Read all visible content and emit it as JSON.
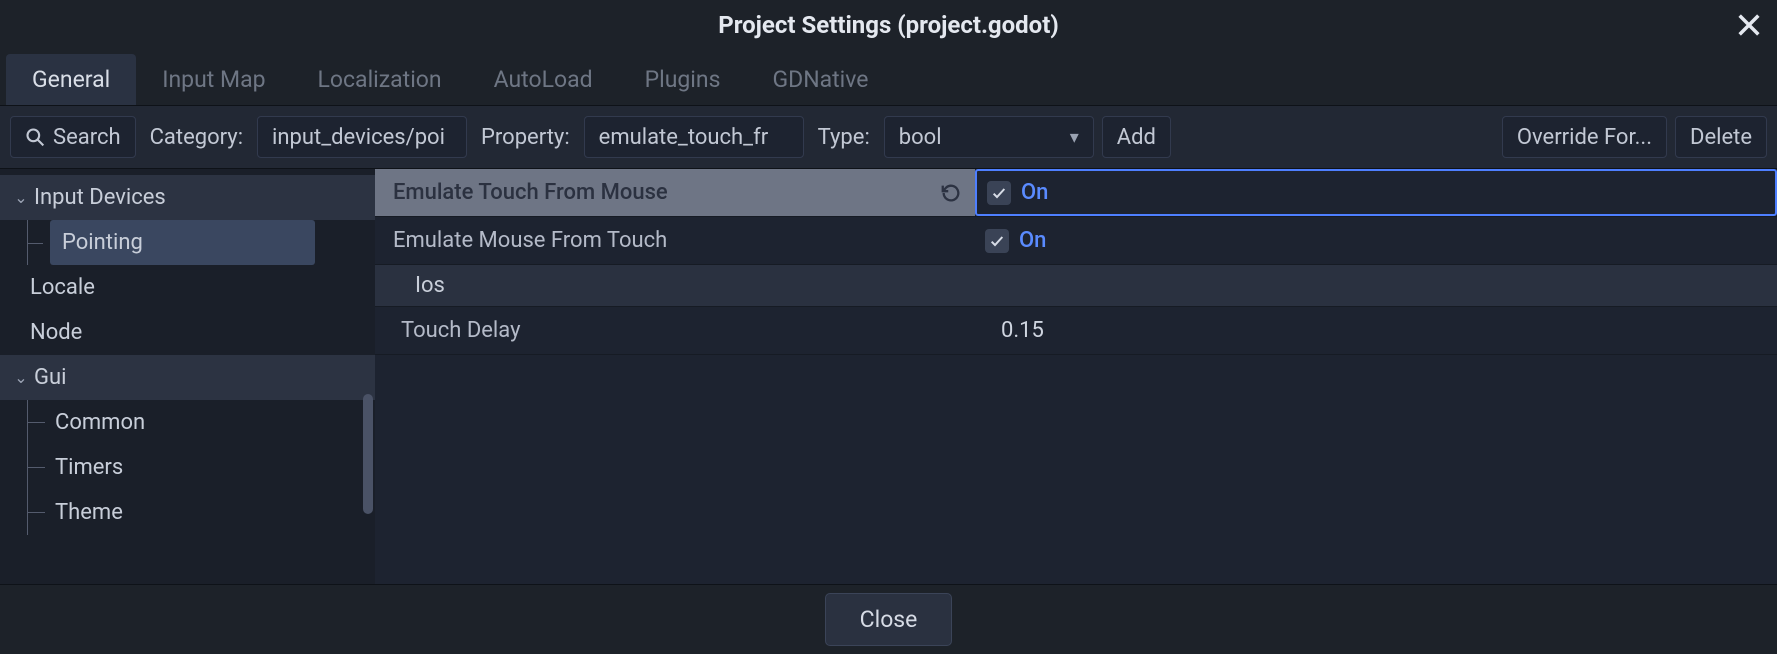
{
  "title": "Project Settings (project.godot)",
  "tabs": [
    "General",
    "Input Map",
    "Localization",
    "AutoLoad",
    "Plugins",
    "GDNative"
  ],
  "active_tab": 0,
  "toolbar": {
    "search_label": "Search",
    "category_label": "Category:",
    "category_value": "input_devices/poi",
    "property_label": "Property:",
    "property_value": "emulate_touch_fr",
    "type_label": "Type:",
    "type_value": "bool",
    "add_label": "Add",
    "override_label": "Override For...",
    "delete_label": "Delete"
  },
  "tree": {
    "items": [
      {
        "label": "Input Devices",
        "kind": "group"
      },
      {
        "label": "Pointing",
        "kind": "child",
        "selected": true
      },
      {
        "label": "Locale",
        "kind": "top"
      },
      {
        "label": "Node",
        "kind": "top"
      },
      {
        "label": "Gui",
        "kind": "group"
      },
      {
        "label": "Common",
        "kind": "child"
      },
      {
        "label": "Timers",
        "kind": "child"
      },
      {
        "label": "Theme",
        "kind": "child"
      }
    ]
  },
  "props": {
    "emulate_touch": {
      "label": "Emulate Touch From Mouse",
      "on_text": "On",
      "checked": true,
      "modified": true
    },
    "emulate_mouse": {
      "label": "Emulate Mouse From Touch",
      "on_text": "On",
      "checked": true
    },
    "ios_section": {
      "label": "Ios"
    },
    "touch_delay": {
      "label": "Touch Delay",
      "value": "0.15"
    }
  },
  "close_label": "Close"
}
